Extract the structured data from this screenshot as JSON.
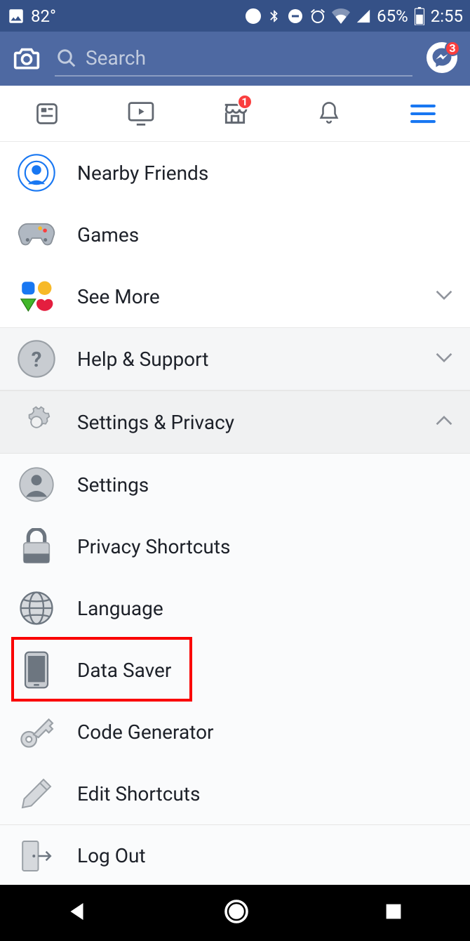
{
  "status": {
    "temperature": "82°",
    "battery_percent": "65%",
    "time": "2:55"
  },
  "search": {
    "placeholder": "Search"
  },
  "messenger_badge": "3",
  "marketplace_badge": "1",
  "menu": {
    "nearby_friends": "Nearby Friends",
    "games": "Games",
    "see_more": "See More",
    "help_support": "Help & Support",
    "settings_privacy": "Settings & Privacy",
    "settings": "Settings",
    "privacy_shortcuts": "Privacy Shortcuts",
    "language": "Language",
    "data_saver": "Data Saver",
    "code_generator": "Code Generator",
    "edit_shortcuts": "Edit Shortcuts",
    "log_out": "Log Out"
  }
}
